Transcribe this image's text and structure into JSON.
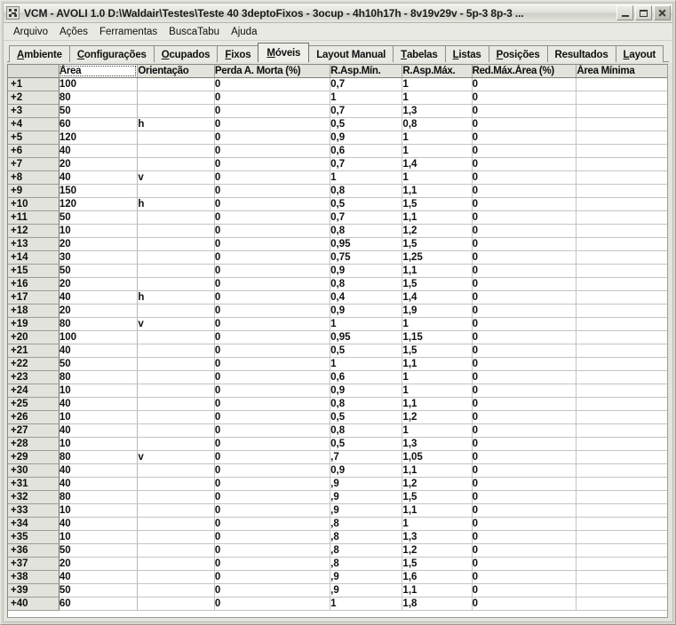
{
  "window": {
    "title": "VCM - AVOLI 1.0  D:\\Waldair\\Testes\\Teste 40 3deptoFixos - 3ocup - 4h10h17h - 8v19v29v - 5p-3  8p-3 ...",
    "icon": "app-grid-icon",
    "controls": {
      "minimize": "minimize-button",
      "maximize": "maximize-button",
      "close": "close-button",
      "close_glyph": "✕"
    }
  },
  "menubar": {
    "items": [
      {
        "label": "Arquivo"
      },
      {
        "label": "Ações"
      },
      {
        "label": "Ferramentas"
      },
      {
        "label": "BuscaTabu"
      },
      {
        "label": "Ajuda"
      }
    ]
  },
  "tabs": {
    "active": "Móveis",
    "items": [
      {
        "label": "Ambiente",
        "accel": "A",
        "rest": "mbiente",
        "active": false
      },
      {
        "label": "Configurações",
        "accel": "C",
        "rest": "onfigurações",
        "active": false
      },
      {
        "label": "Ocupados",
        "accel": "O",
        "rest": "cupados",
        "active": false
      },
      {
        "label": "Fixos",
        "accel": "F",
        "rest": "ixos",
        "active": false
      },
      {
        "label": "Móveis",
        "accel": "M",
        "rest": "óveis",
        "active": true
      },
      {
        "label": "Layout Manual",
        "accel": "",
        "rest": "Layout Manual",
        "active": false
      },
      {
        "label": "Tabelas",
        "accel": "T",
        "rest": "abelas",
        "active": false
      },
      {
        "label": "Listas",
        "accel": "L",
        "rest": "istas",
        "active": false
      },
      {
        "label": "Posições",
        "accel": "P",
        "rest": "osições",
        "active": false
      },
      {
        "label": "Resultados",
        "accel": "",
        "rest": "Resultados",
        "active": false
      },
      {
        "label": "Layout",
        "accel": "L",
        "rest": "ayout",
        "active": false
      }
    ]
  },
  "grid": {
    "columns": [
      {
        "key": "rowhead",
        "label": ""
      },
      {
        "key": "area",
        "label": "Área",
        "focused": true
      },
      {
        "key": "orient",
        "label": "Orientação"
      },
      {
        "key": "perda",
        "label": "Perda A. Morta (%)"
      },
      {
        "key": "rmin",
        "label": "R.Asp.Mín."
      },
      {
        "key": "rmax",
        "label": "R.Asp.Máx."
      },
      {
        "key": "red",
        "label": "Red.Máx.Área (%)"
      },
      {
        "key": "amin",
        "label": "Área Mínima"
      }
    ],
    "rows": [
      {
        "h": "+1",
        "area": "100",
        "orient": "",
        "perda": "0",
        "rmin": "0,7",
        "rmax": "1",
        "red": "0",
        "amin": ""
      },
      {
        "h": "+2",
        "area": "80",
        "orient": "",
        "perda": "0",
        "rmin": "1",
        "rmax": "1",
        "red": "0",
        "amin": ""
      },
      {
        "h": "+3",
        "area": "50",
        "orient": "",
        "perda": "0",
        "rmin": "0,7",
        "rmax": "1,3",
        "red": "0",
        "amin": ""
      },
      {
        "h": "+4",
        "area": "60",
        "orient": "h",
        "perda": "0",
        "rmin": "0,5",
        "rmax": "0,8",
        "red": "0",
        "amin": ""
      },
      {
        "h": "+5",
        "area": "120",
        "orient": "",
        "perda": "0",
        "rmin": "0,9",
        "rmax": "1",
        "red": "0",
        "amin": ""
      },
      {
        "h": "+6",
        "area": "40",
        "orient": "",
        "perda": "0",
        "rmin": "0,6",
        "rmax": "1",
        "red": "0",
        "amin": ""
      },
      {
        "h": "+7",
        "area": "20",
        "orient": "",
        "perda": "0",
        "rmin": "0,7",
        "rmax": "1,4",
        "red": "0",
        "amin": ""
      },
      {
        "h": "+8",
        "area": "40",
        "orient": "v",
        "perda": "0",
        "rmin": "1",
        "rmax": "1",
        "red": "0",
        "amin": ""
      },
      {
        "h": "+9",
        "area": "150",
        "orient": "",
        "perda": "0",
        "rmin": "0,8",
        "rmax": "1,1",
        "red": "0",
        "amin": ""
      },
      {
        "h": "+10",
        "area": "120",
        "orient": "h",
        "perda": "0",
        "rmin": "0,5",
        "rmax": "1,5",
        "red": "0",
        "amin": ""
      },
      {
        "h": "+11",
        "area": "50",
        "orient": "",
        "perda": "0",
        "rmin": "0,7",
        "rmax": "1,1",
        "red": "0",
        "amin": ""
      },
      {
        "h": "+12",
        "area": "10",
        "orient": "",
        "perda": "0",
        "rmin": "0,8",
        "rmax": "1,2",
        "red": "0",
        "amin": ""
      },
      {
        "h": "+13",
        "area": "20",
        "orient": "",
        "perda": "0",
        "rmin": "0,95",
        "rmax": "1,5",
        "red": "0",
        "amin": ""
      },
      {
        "h": "+14",
        "area": "30",
        "orient": "",
        "perda": "0",
        "rmin": "0,75",
        "rmax": "1,25",
        "red": "0",
        "amin": ""
      },
      {
        "h": "+15",
        "area": "50",
        "orient": "",
        "perda": "0",
        "rmin": "0,9",
        "rmax": "1,1",
        "red": "0",
        "amin": ""
      },
      {
        "h": "+16",
        "area": "20",
        "orient": "",
        "perda": "0",
        "rmin": "0,8",
        "rmax": "1,5",
        "red": "0",
        "amin": ""
      },
      {
        "h": "+17",
        "area": "40",
        "orient": "h",
        "perda": "0",
        "rmin": "0,4",
        "rmax": "1,4",
        "red": "0",
        "amin": ""
      },
      {
        "h": "+18",
        "area": "20",
        "orient": "",
        "perda": "0",
        "rmin": "0,9",
        "rmax": "1,9",
        "red": "0",
        "amin": ""
      },
      {
        "h": "+19",
        "area": "80",
        "orient": "v",
        "perda": "0",
        "rmin": "1",
        "rmax": "1",
        "red": "0",
        "amin": ""
      },
      {
        "h": "+20",
        "area": "100",
        "orient": "",
        "perda": "0",
        "rmin": "0,95",
        "rmax": "1,15",
        "red": "0",
        "amin": ""
      },
      {
        "h": "+21",
        "area": "40",
        "orient": "",
        "perda": "0",
        "rmin": "0,5",
        "rmax": "1,5",
        "red": "0",
        "amin": ""
      },
      {
        "h": "+22",
        "area": "50",
        "orient": "",
        "perda": "0",
        "rmin": "1",
        "rmax": "1,1",
        "red": "0",
        "amin": ""
      },
      {
        "h": "+23",
        "area": "80",
        "orient": "",
        "perda": "0",
        "rmin": "0,6",
        "rmax": "1",
        "red": "0",
        "amin": ""
      },
      {
        "h": "+24",
        "area": "10",
        "orient": "",
        "perda": "0",
        "rmin": "0,9",
        "rmax": "1",
        "red": "0",
        "amin": ""
      },
      {
        "h": "+25",
        "area": "40",
        "orient": "",
        "perda": "0",
        "rmin": "0,8",
        "rmax": "1,1",
        "red": "0",
        "amin": ""
      },
      {
        "h": "+26",
        "area": "10",
        "orient": "",
        "perda": "0",
        "rmin": "0,5",
        "rmax": "1,2",
        "red": "0",
        "amin": ""
      },
      {
        "h": "+27",
        "area": "40",
        "orient": "",
        "perda": "0",
        "rmin": "0,8",
        "rmax": "1",
        "red": "0",
        "amin": ""
      },
      {
        "h": "+28",
        "area": "10",
        "orient": "",
        "perda": "0",
        "rmin": "0,5",
        "rmax": "1,3",
        "red": "0",
        "amin": ""
      },
      {
        "h": "+29",
        "area": "80",
        "orient": "v",
        "perda": "0",
        "rmin": ",7",
        "rmax": "1,05",
        "red": "0",
        "amin": ""
      },
      {
        "h": "+30",
        "area": "40",
        "orient": "",
        "perda": "0",
        "rmin": "0,9",
        "rmax": "1,1",
        "red": "0",
        "amin": ""
      },
      {
        "h": "+31",
        "area": "40",
        "orient": "",
        "perda": "0",
        "rmin": ",9",
        "rmax": "1,2",
        "red": "0",
        "amin": ""
      },
      {
        "h": "+32",
        "area": "80",
        "orient": "",
        "perda": "0",
        "rmin": ",9",
        "rmax": "1,5",
        "red": "0",
        "amin": ""
      },
      {
        "h": "+33",
        "area": "10",
        "orient": "",
        "perda": "0",
        "rmin": ",9",
        "rmax": "1,1",
        "red": "0",
        "amin": ""
      },
      {
        "h": "+34",
        "area": "40",
        "orient": "",
        "perda": "0",
        "rmin": ",8",
        "rmax": "1",
        "red": "0",
        "amin": ""
      },
      {
        "h": "+35",
        "area": "10",
        "orient": "",
        "perda": "0",
        "rmin": ",8",
        "rmax": "1,3",
        "red": "0",
        "amin": ""
      },
      {
        "h": "+36",
        "area": "50",
        "orient": "",
        "perda": "0",
        "rmin": ",8",
        "rmax": "1,2",
        "red": "0",
        "amin": ""
      },
      {
        "h": "+37",
        "area": "20",
        "orient": "",
        "perda": "0",
        "rmin": ",8",
        "rmax": "1,5",
        "red": "0",
        "amin": ""
      },
      {
        "h": "+38",
        "area": "40",
        "orient": "",
        "perda": "0",
        "rmin": ",9",
        "rmax": "1,6",
        "red": "0",
        "amin": ""
      },
      {
        "h": "+39",
        "area": "50",
        "orient": "",
        "perda": "0",
        "rmin": ",9",
        "rmax": "1,1",
        "red": "0",
        "amin": ""
      },
      {
        "h": "+40",
        "area": "60",
        "orient": "",
        "perda": "0",
        "rmin": "1",
        "rmax": "1,8",
        "red": "0",
        "amin": ""
      }
    ]
  }
}
